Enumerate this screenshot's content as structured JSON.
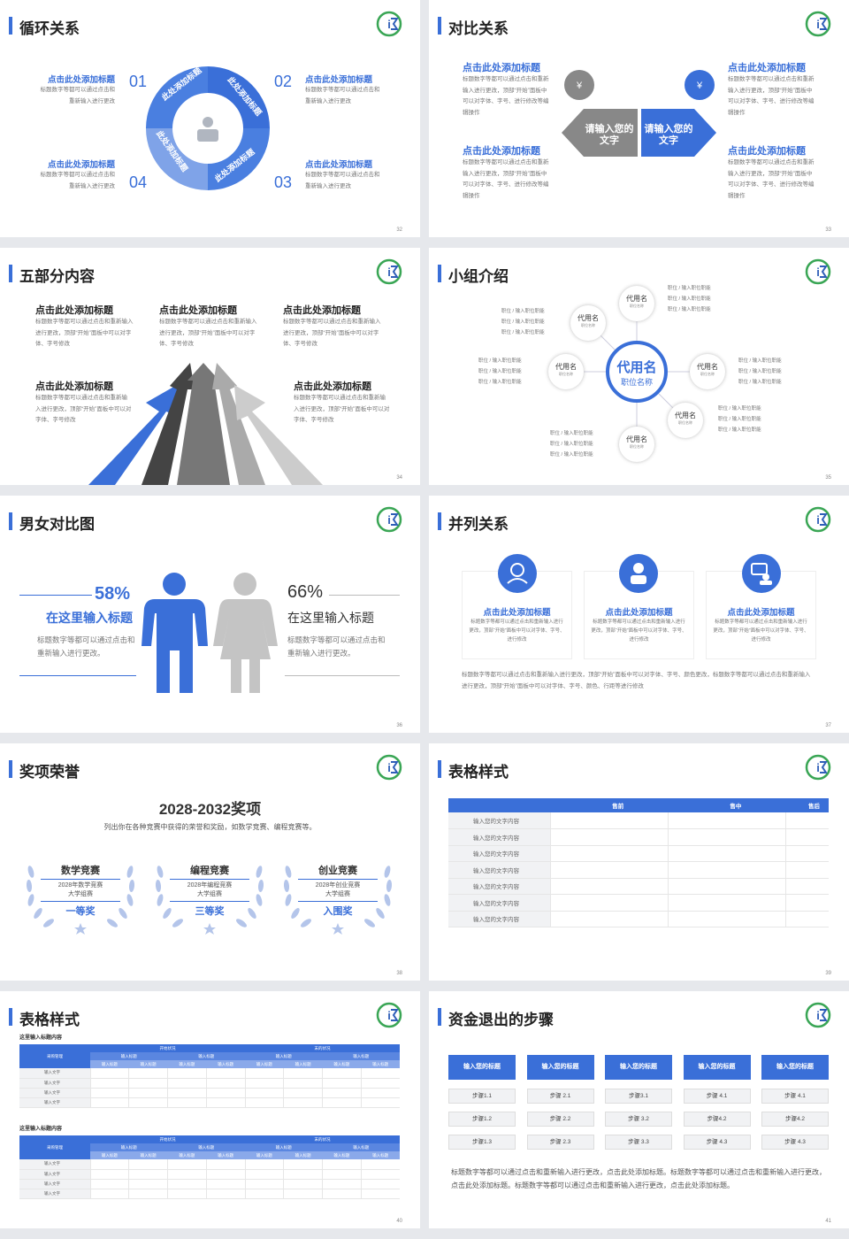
{
  "common": {
    "add_title": "点击此处添加标题",
    "body_short": "标题数字等都可以通过点击和重新输入进行更改",
    "body_long": "标题数字等都可以通过点击和重新输入进行更改，顶部“开始”面板中可以对字体、字号、进行修改等编辑操作",
    "colors": {
      "accent": "#3a6fd8",
      "dark_gray": "#666666",
      "light_gray": "#bdbdbd"
    }
  },
  "slides": [
    {
      "page": "32",
      "title": "循环关系",
      "items": [
        {
          "num": "01",
          "title": "点击此处添加标题",
          "body": "标题数字等都可以通过点击和重新输入进行更改"
        },
        {
          "num": "02",
          "title": "点击此处添加标题",
          "body": "标题数字等都可以通过点击和重新输入进行更改"
        },
        {
          "num": "03",
          "title": "点击此处添加标题",
          "body": "标题数字等都可以通过点击和重新输入进行更改"
        },
        {
          "num": "04",
          "title": "点击此处添加标题",
          "body": "标题数字等都可以通过点击和重新输入进行更改"
        }
      ],
      "ring_labels": [
        "此处添加标题",
        "此处添加标题",
        "此处添加标题",
        "此处添加标题"
      ]
    },
    {
      "page": "33",
      "title": "对比关系",
      "items": [
        {
          "title": "点击此处添加标题",
          "body": "标题数字等都可以通过点击和重新输入进行更改，顶部“开始”面板中可以对字体、字号、进行修改等编辑操作"
        },
        {
          "title": "点击此处添加标题",
          "body": "标题数字等都可以通过点击和重新输入进行更改，顶部“开始”面板中可以对字体、字号、进行修改等编辑操作"
        },
        {
          "title": "点击此处添加标题",
          "body": "标题数字等都可以通过点击和重新输入进行更改，顶部“开始”面板中可以对字体、字号、进行修改等编辑操作"
        },
        {
          "title": "点击此处添加标题",
          "body": "标题数字等都可以通过点击和重新输入进行更改，顶部“开始”面板中可以对字体、字号、进行修改等编辑操作"
        }
      ],
      "arrow_left": "请输入您的文字",
      "arrow_right": "请输入您的文字"
    },
    {
      "page": "34",
      "title": "五部分内容",
      "items": [
        {
          "title": "点击此处添加标题",
          "body": "标题数字等都可以通过点击和重新输入进行更改，顶部“开始”面板中可以对字体、字号修改"
        },
        {
          "title": "点击此处添加标题",
          "body": "标题数字等都可以通过点击和重新输入进行更改，顶部“开始”面板中可以对字体、字号修改"
        },
        {
          "title": "点击此处添加标题",
          "body": "标题数字等都可以通过点击和重新输入进行更改，顶部“开始”面板中可以对字体、字号修改"
        },
        {
          "title": "点击此处添加标题",
          "body": "标题数字等都可以通过点击和重新输入进行更改，顶部“开始”面板中可以对字体、字号修改"
        },
        {
          "title": "点击此处添加标题",
          "body": "标题数字等都可以通过点击和重新输入进行更改，顶部“开始”面板中可以对字体、字号修改"
        }
      ]
    },
    {
      "page": "35",
      "title": "小组介绍",
      "center_name": "代用名",
      "center_role": "职位名称",
      "member_name": "代用名",
      "member_role": "职位名称",
      "role_line": "职位 / 输入职位职能"
    },
    {
      "page": "36",
      "title": "男女对比图",
      "left_pct": "58%",
      "right_pct": "66%",
      "left_title": "在这里输入标题",
      "right_title": "在这里输入标题",
      "body": "标题数字等都可以通过点击和重新输入进行更改。"
    },
    {
      "page": "37",
      "title": "并列关系",
      "items": [
        {
          "title": "点击此处添加标题",
          "body": "标题数字等都可以通过点击和重新输入进行更改，顶部“开始”面板中可以对字体、字号、进行修改"
        },
        {
          "title": "点击此处添加标题",
          "body": "标题数字等都可以通过点击和重新输入进行更改，顶部“开始”面板中可以对字体、字号、进行修改"
        },
        {
          "title": "点击此处添加标题",
          "body": "标题数字等都可以通过点击和重新输入进行更改，顶部“开始”面板中可以对字体、字号、进行修改"
        }
      ],
      "footer": "标题数字等都可以通过点击和重新输入进行更改，顶部“开始”面板中可以对字体、字号、颜色更改，标题数字等都可以通过点击和重新输入进行更改，顶部“开始”面板中可以对字体、字号、颜色、行距等进行修改"
    },
    {
      "page": "38",
      "title": "奖项荣誉",
      "headline": "2028-2032奖项",
      "subline": "列出你在各种竞赛中获得的荣誉和奖励，如数学竞赛、编程竞赛等。",
      "awards": [
        {
          "name": "数学竞赛",
          "line1": "2028年数学竞赛",
          "line2": "大学组赛",
          "prize": "一等奖"
        },
        {
          "name": "编程竞赛",
          "line1": "2028年编程竞赛",
          "line2": "大学组赛",
          "prize": "三等奖"
        },
        {
          "name": "创业竞赛",
          "line1": "2028年创业竞赛",
          "line2": "大学组赛",
          "prize": "入围奖"
        }
      ]
    },
    {
      "page": "39",
      "title": "表格样式",
      "headers": [
        "售前",
        "售中",
        "售后"
      ],
      "row_label": "输入您的文字内容",
      "row_count": 7
    },
    {
      "page": "40",
      "title": "表格样式",
      "caption": "这里输入标题内容",
      "col_group1": "开始状况",
      "col_group2": "末的状况",
      "row_header": "采购管理",
      "sub_header": "输入标题",
      "sub_sub_header": "输入标题",
      "row_label": "输入文字"
    },
    {
      "page": "41",
      "title": "资金退出的步骤",
      "columns": [
        {
          "head": "输入您的标题",
          "steps": [
            "步骤1.1",
            "步骤 2.1",
            "步骤3.1",
            "步骤 4.1",
            "步骤 4.1"
          ]
        },
        {
          "head": "输入您的标题",
          "steps": [
            "步骤1.2",
            "步骤 2.2",
            "步骤 3.2",
            "步骤4.2",
            "步骤4.2"
          ]
        },
        {
          "head": "输入您的标题",
          "steps": [
            "步骤1.3",
            "步骤 2.3",
            "步骤 3.3",
            "步骤 4.3",
            "步骤 4.3"
          ]
        }
      ],
      "col_heads": [
        "输入您的标题",
        "输入您的标题",
        "输入您的标题",
        "输入您的标题",
        "输入您的标题"
      ],
      "rows": [
        [
          "步骤1.1",
          "步骤 2.1",
          "步骤3.1",
          "步骤 4.1",
          "步骤 4.1"
        ],
        [
          "步骤1.2",
          "步骤 2.2",
          "步骤 3.2",
          "步骤4.2",
          "步骤4.2"
        ],
        [
          "步骤1.3",
          "步骤 2.3",
          "步骤 3.3",
          "步骤 4.3",
          "步骤 4.3"
        ]
      ],
      "footer": "标题数字等都可以通过点击和重新输入进行更改，点击此处添加标题。标题数字等都可以通过点击和重新输入进行更改，点击此处添加标题。标题数字等都可以通过点击和重新输入进行更改，点击此处添加标题。"
    }
  ]
}
